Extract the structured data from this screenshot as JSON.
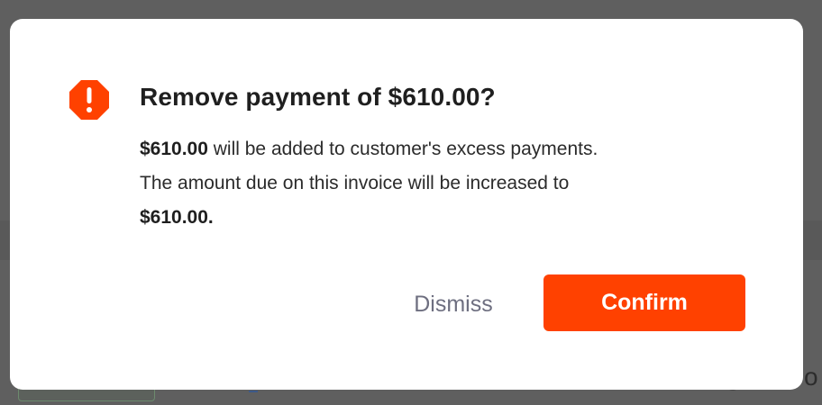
{
  "dialog": {
    "icon": "alert-octagon-icon",
    "title": "Remove payment of $610.00?",
    "message": {
      "amount": "$610.00",
      "line1_rest": " will be added to customer's excess payments.",
      "line2": "The amount due on this invoice will be increased to",
      "new_amount": "$610.00."
    },
    "dismiss_label": "Dismiss",
    "confirm_label": "Confirm"
  },
  "background": {
    "edge_text": "o"
  },
  "colors": {
    "accent": "#ff4100",
    "icon": "#ff4100",
    "overlay": "#5f5f5f",
    "dismiss_text": "#6e6f80"
  }
}
